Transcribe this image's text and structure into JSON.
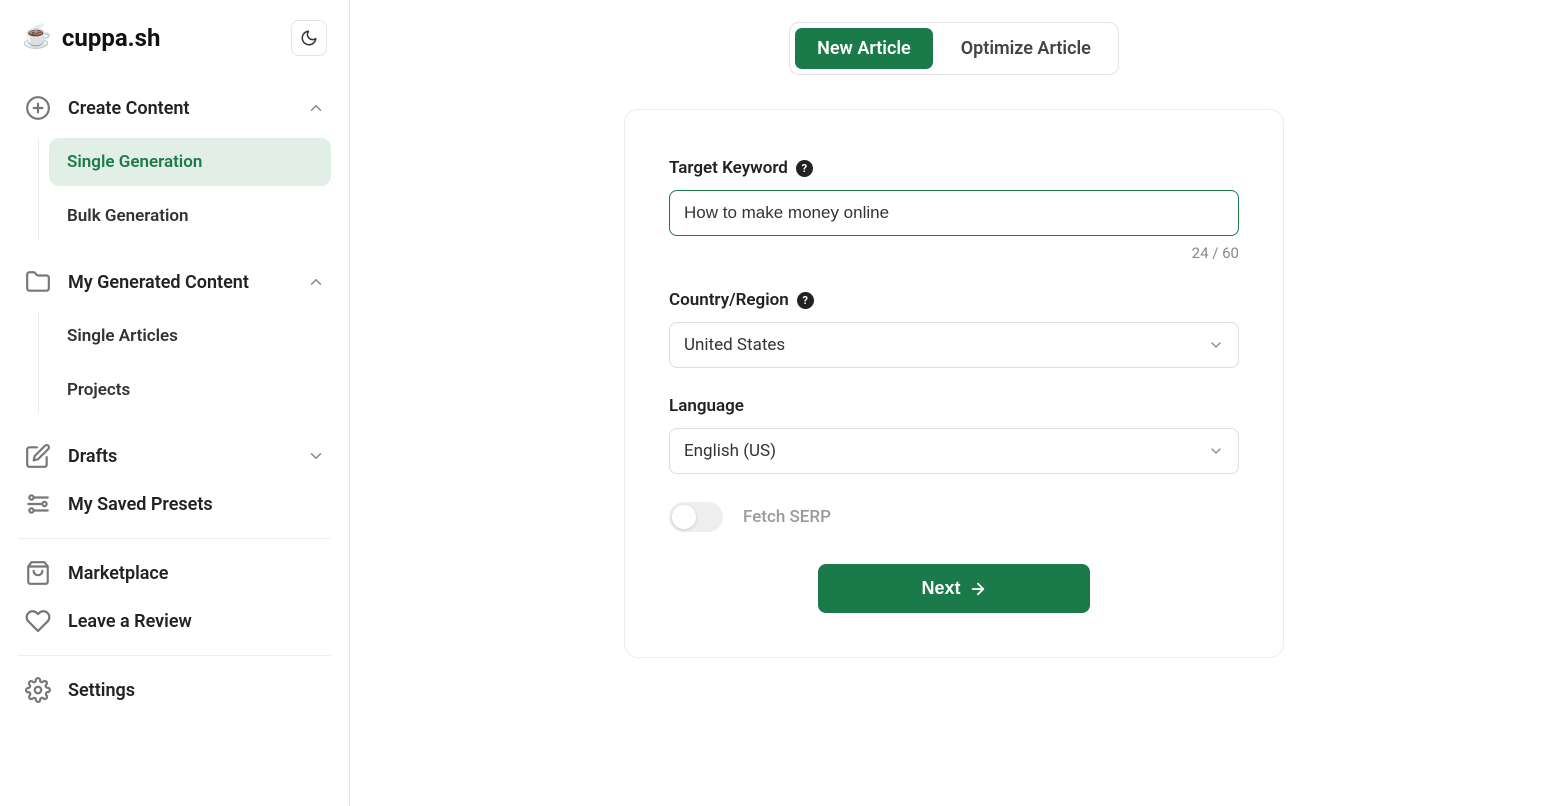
{
  "brand": {
    "name": "cuppa.sh"
  },
  "sidebar": {
    "sections": [
      {
        "label": "Create Content",
        "children": [
          {
            "label": "Single Generation",
            "active": true
          },
          {
            "label": "Bulk Generation",
            "active": false
          }
        ]
      },
      {
        "label": "My Generated Content",
        "children": [
          {
            "label": "Single Articles",
            "active": false
          },
          {
            "label": "Projects",
            "active": false
          }
        ]
      }
    ],
    "items": [
      {
        "label": "Drafts"
      },
      {
        "label": "My Saved Presets"
      },
      {
        "label": "Marketplace"
      },
      {
        "label": "Leave a Review"
      },
      {
        "label": "Settings"
      }
    ]
  },
  "tabs": {
    "new_article": "New Article",
    "optimize_article": "Optimize Article"
  },
  "form": {
    "keyword_label": "Target Keyword",
    "keyword_value": "How to make money online",
    "keyword_count": "24 / 60",
    "country_label": "Country/Region",
    "country_value": "United States",
    "language_label": "Language",
    "language_value": "English (US)",
    "fetch_serp_label": "Fetch SERP",
    "next_label": "Next"
  }
}
